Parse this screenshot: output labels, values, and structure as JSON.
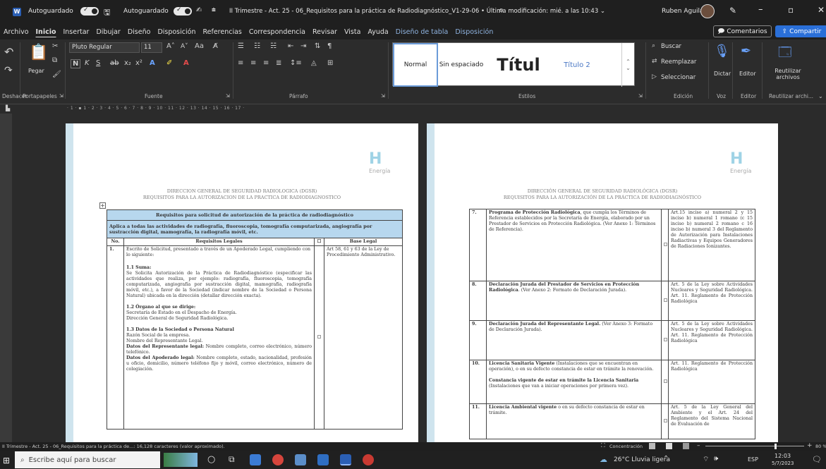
{
  "titlebar": {
    "autosave1": "Autoguardado",
    "autosave2": "Autoguardado",
    "title": "II Trimestre - Act. 25 - 06_Requisitos para la práctica de Radiodiagnóstico_V1-29-06 • Última modificación: mié. a las 10:43 ⌄",
    "user": "Ruben Aguilar"
  },
  "menu": [
    "Archivo",
    "Inicio",
    "Insertar",
    "Dibujar",
    "Diseño",
    "Disposición",
    "Referencias",
    "Correspondencia",
    "Revisar",
    "Vista",
    "Ayuda",
    "Diseño de tabla",
    "Disposición"
  ],
  "menu_buttons": {
    "comments": "Comentarios",
    "share": "Compartir"
  },
  "ribbon": {
    "paste": "Pegar",
    "font_name": "Pluto Regular",
    "font_size": "11",
    "groups": {
      "clipboard": "Portapapeles",
      "font": "Fuente",
      "paragraph": "Párrafo",
      "styles": "Estilos",
      "editing": "Edición",
      "voice": "Voz",
      "editor": "Editor",
      "reuse": "Reutilizar archi..."
    },
    "undo": "Deshacer",
    "styles": {
      "normal": "Normal",
      "nospace": "Sin espaciado",
      "title": "Títul",
      "title2": "Título 2"
    },
    "find": "Buscar",
    "replace": "Reemplazar",
    "select": "Seleccionar",
    "dictate": "Dictar",
    "editor_btn": "Editor",
    "reuse_btn": "Reutilizar archivos"
  },
  "ruler": "· 1 · ▪ 1 · 2 · 3 · 4 · 5 · 6 · 7 · 8 · 9 · 10 · 11 · 12 · 13 · 14 · 15 · 16 · 17 ·",
  "page1": {
    "logo": "H",
    "logo_sub": "Energía",
    "header1": "DIRECCION GENERAL DE SEGURIDAD RADIOLOGICA (DGSR)",
    "header2": "REQUISITOS PARA LA AUTORIZACION DE LA PRACTICA DE RADIODIAGNOSTICO",
    "table_title": "Requisitos para solicitud de autorización de la práctica de radiodiagnóstico",
    "table_sub": "Aplica a todas las actividades de radiografía, fluoroscopia, tomografía computarizada, angiografía por sustracción digital, mamografía, la radiografía móvil, etc.",
    "cols": [
      "No.",
      "Requisitos Legales",
      "☐",
      "Base Legal"
    ],
    "row_no": "1.",
    "row_text": "Escrito de Solicitud, presentado a través de un Apoderado Legal, cumpliendo con lo siguiente:",
    "legal": "Art 58, 61 y 63 de la Ley de Procedimiento Administrativo.",
    "s1_title": "1.1 Suma:",
    "s1_text": "Se Solicita Autorización de la Práctica de Radiodiagnóstico (especificar las actividades que realiza, por ejemplo: radiografía, fluoroscopia, tomografía computarizada, angiografía por sustracción digital, mamografía, radiografía móvil, etc.), a favor de la Sociedad (indicar nombre de la Sociedad o Persona Natural) ubicada en la dirección (detallar dirección exacta).",
    "s2_title": "1.2 Órgano al que se dirige:",
    "s2_text1": "Secretaría de Estado en el Despacho de Energía.",
    "s2_text2": "Dirección General de Seguridad Radiológica.",
    "s3_title": "1.3 Datos de la Sociedad o Persona Natural",
    "s3_l1": "Razón Social de la empresa.",
    "s3_l2": "Nombre del Representante Legal.",
    "s3_b1": "Datos del Representante legal:",
    "s3_t1": " Nombre completo, correo electrónico, número telefónico.",
    "s3_b2": "Datos del Apoderado legal:",
    "s3_t2": " Nombre completo, estado, nacionalidad, profesión u oficio, domicilio, número teléfono fijo y móvil, correo electrónico, número de colegiación."
  },
  "page2": {
    "logo": "H",
    "logo_sub": "Energía",
    "header1": "DIRECCIÓN GENERAL DE SEGURIDAD RADIOLÓGICA (DGSR)",
    "header2": "REQUISITOS PARA LA AUTORIZACIÓN DE LA PRÁCTICA DE RADIODIAGNÓSTICO",
    "rows": [
      {
        "no": "7.",
        "bold": "Programa de Protección Radiológica",
        "text": ", que cumpla los Términos de Referencia establecidos por la Secretaría de Energía, elaborado por un Prestador de Servicios en Protección Radiológica. (Ver Anexo 1: Términos de Referencia).",
        "extra_bold": "",
        "extra": "",
        "legal": "Art.15 inciso a) numeral 2 y 15 inciso b) numeral 1 romano (c 15 inciso b) numeral 2 romano c 16 inciso b) numeral 3 del Reglamento de Autorización para Instalaciones Radiactivas y Equipos Generadores de Radiaciones Ionizantes."
      },
      {
        "no": "8.",
        "bold": "Declaración Jurada del Prestador de Servicios en Protección Radiológica",
        "text": ". (Ver Anexo 2: Formato de Declaración Jurada).",
        "extra_bold": "",
        "extra": "",
        "legal": "Art. 5 de la Ley sobre Actividades Nucleares y Seguridad Radiológica. Art. 11. Reglamento de Protección Radiológica"
      },
      {
        "no": "9.",
        "bold": "Declaración Jurada del Representante Legal.",
        "text": " (Ver Anexo 3: Formato de Declaración Jurada).",
        "extra_bold": "",
        "extra": "",
        "legal": "Art. 5 de la Ley sobre Actividades Nucleares y Seguridad Radiológica. Art. 11. Reglamento de Protección Radiológica"
      },
      {
        "no": "10.",
        "bold": "Licencia Sanitaria Vigente",
        "text": " (Instalaciones que se encuentran en operación), o en su defecto constancia de estar en trámite la renovación.",
        "extra_bold": "Constancia vigente de estar en trámite la Licencia Sanitaria",
        "extra": " (Instalaciones que van a iniciar operaciones por primera vez).",
        "legal": "Art. 11. Reglamento de Protección Radiológica"
      },
      {
        "no": "11.",
        "bold": "Licencia Ambiental vigente",
        "text": " o en su defecto constancia de estar en trámite.",
        "extra_bold": "",
        "extra": "",
        "legal": "Art. 5 de la Ley General del Ambiente y el Art. 24 del Reglamento del Sistema Nacional de Evaluación de"
      }
    ]
  },
  "status": {
    "left": "II Trimestre - Act. 25 - 06_Requisitos para la práctica de...: 16,128 caracteres (valor aproximado).",
    "focus": "Concentración",
    "zoom": "80 %"
  },
  "taskbar": {
    "search": "Escribe aquí para buscar",
    "weather": "26°C  Lluvia ligera",
    "lang": "ESP",
    "time": "12:03",
    "date": "5/7/2023"
  }
}
